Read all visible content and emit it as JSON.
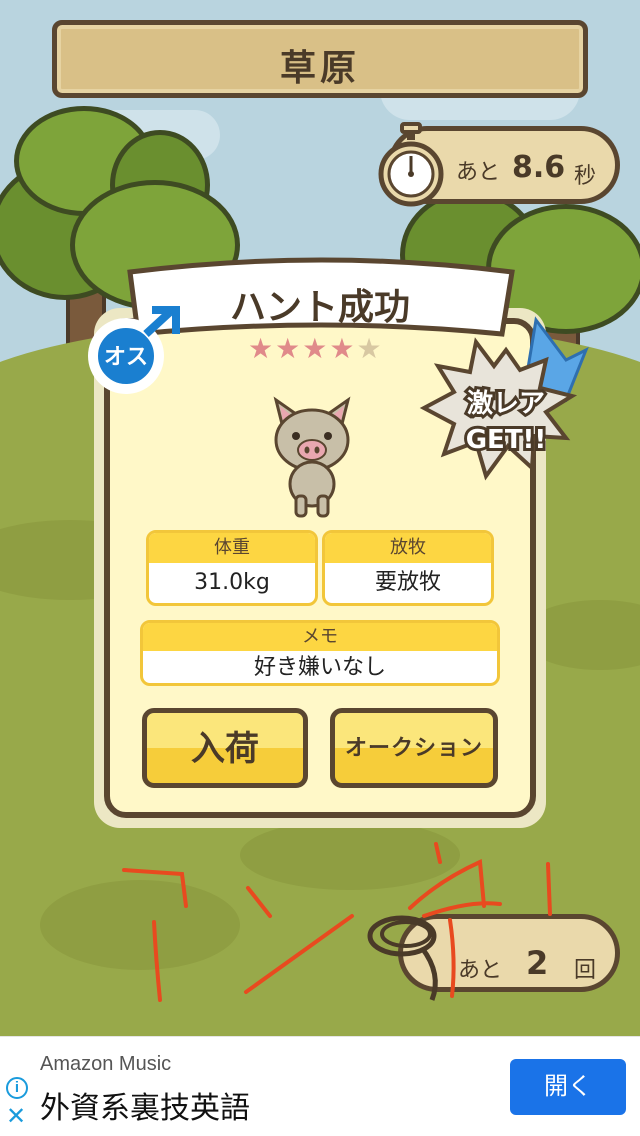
{
  "header": {
    "title": "草原"
  },
  "timer": {
    "prefix": "あと",
    "value": "8.6",
    "unit": "秒"
  },
  "result": {
    "title": "ハント成功",
    "rarity_stars": 4,
    "rarity_max": 5,
    "gender_badge": "オス",
    "rare_badge_line1": "激レア",
    "rare_badge_line2": "GET!!",
    "stats": [
      {
        "label": "体重",
        "value": "31.0kg"
      },
      {
        "label": "放牧",
        "value": "要放牧"
      }
    ],
    "memo": {
      "label": "メモ",
      "value": "好き嫌いなし"
    },
    "buttons": {
      "store": "入荷",
      "auction": "オークション"
    }
  },
  "remaining": {
    "prefix": "あと",
    "value": "2",
    "unit": "回"
  },
  "ad": {
    "source": "Amazon Music",
    "title": "外資系裏技英語",
    "open_label": "開く",
    "info_icon": "i",
    "close_icon": "✕"
  },
  "colors": {
    "accent_yellow": "#fdd642",
    "board": "#d9c087",
    "outline": "#5a4630",
    "scribble": "#e84a1f"
  }
}
